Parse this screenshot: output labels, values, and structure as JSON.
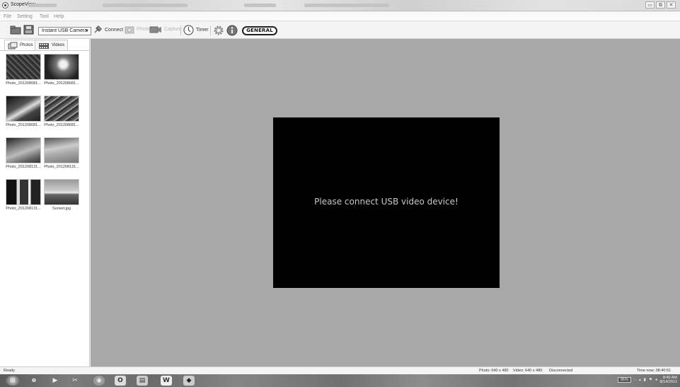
{
  "window": {
    "title": "ScopeView",
    "controls": [
      "▭",
      "⧉",
      "✕"
    ]
  },
  "menu": [
    "File",
    "Setting",
    "Tool",
    "Help"
  ],
  "toolbar": {
    "camera_selected": "Instant USB Camera",
    "connect_label": "Connect",
    "photo_label": "Photo",
    "capture_label": "Capture",
    "timer_label": "Timer",
    "brand_logo": "GENERAL"
  },
  "tabs": {
    "photos": "Photos",
    "videos": "Videos"
  },
  "thumbnails": [
    {
      "name": "Photo_201208081..."
    },
    {
      "name": "Photo_201208081..."
    },
    {
      "name": "Photo_201208081..."
    },
    {
      "name": "Photo_201208081..."
    },
    {
      "name": "Photo_201208131..."
    },
    {
      "name": "Photo_201208131..."
    },
    {
      "name": "Photo_201208131..."
    },
    {
      "name": "Sunset.jpg"
    }
  ],
  "viewer": {
    "message": "Please connect USB video device!"
  },
  "status": {
    "left": "Ready",
    "photo_res": "Photo: 640 x 480",
    "video_res": "Video: 640 x 480",
    "connection": "Disconnected",
    "time_now": "Time now: 08:40:51"
  },
  "taskbar": {
    "clock_time": "8:40 AM",
    "clock_date": "8/14/2012",
    "battery": "96%"
  }
}
